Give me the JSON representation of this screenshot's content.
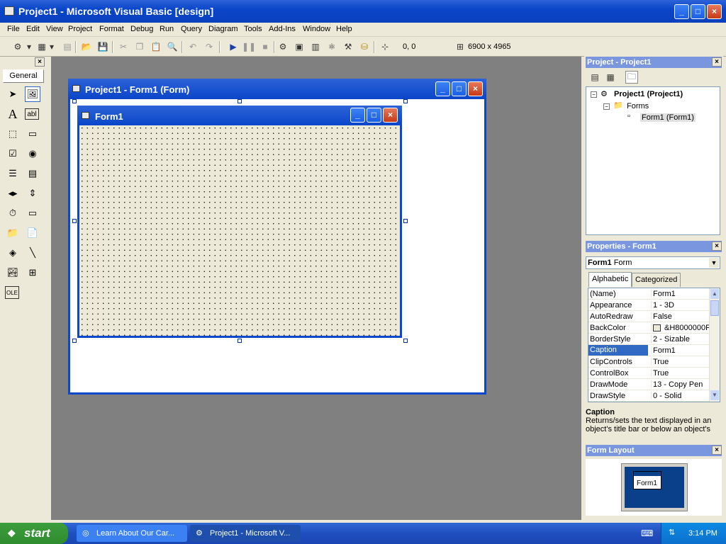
{
  "app": {
    "title": "Project1 - Microsoft Visual Basic [design]"
  },
  "menu": [
    {
      "label": "File"
    },
    {
      "label": "Edit"
    },
    {
      "label": "View"
    },
    {
      "label": "Project"
    },
    {
      "label": "Format"
    },
    {
      "label": "Debug"
    },
    {
      "label": "Run"
    },
    {
      "label": "Query"
    },
    {
      "label": "Diagram"
    },
    {
      "label": "Tools"
    },
    {
      "label": "Add-Ins"
    },
    {
      "label": "Window"
    },
    {
      "label": "Help"
    }
  ],
  "toolbar": {
    "position": "0, 0",
    "size": "6900 x 4965"
  },
  "toolbox": {
    "tab_label": "General"
  },
  "mdi": {
    "title": "Project1 - Form1 (Form)",
    "form_title": "Form1"
  },
  "project": {
    "header": "Project - Project1",
    "tree": {
      "root": "Project1 (Project1)",
      "folder": "Forms",
      "item": "Form1 (Form1)"
    }
  },
  "properties": {
    "header": "Properties - Form1",
    "object_name": "Form1",
    "object_type": "Form",
    "tabs": [
      "Alphabetic",
      "Categorized"
    ],
    "rows": [
      {
        "name": "(Name)",
        "value": "Form1"
      },
      {
        "name": "Appearance",
        "value": "1 - 3D"
      },
      {
        "name": "AutoRedraw",
        "value": "False"
      },
      {
        "name": "BackColor",
        "value": "&H8000000F"
      },
      {
        "name": "BorderStyle",
        "value": "2 - Sizable"
      },
      {
        "name": "Caption",
        "value": "Form1"
      },
      {
        "name": "ClipControls",
        "value": "True"
      },
      {
        "name": "ControlBox",
        "value": "True"
      },
      {
        "name": "DrawMode",
        "value": "13 - Copy Pen"
      },
      {
        "name": "DrawStyle",
        "value": "0 - Solid"
      }
    ],
    "desc_title": "Caption",
    "desc_text": "Returns/sets the text displayed in an object's title bar or below an object's"
  },
  "form_layout": {
    "header": "Form Layout",
    "preview_label": "Form1"
  },
  "taskbar": {
    "start_label": "start",
    "tasks": [
      {
        "label": "Learn About Our Car..."
      },
      {
        "label": "Project1 - Microsoft V..."
      }
    ],
    "clock": "3:14 PM"
  }
}
